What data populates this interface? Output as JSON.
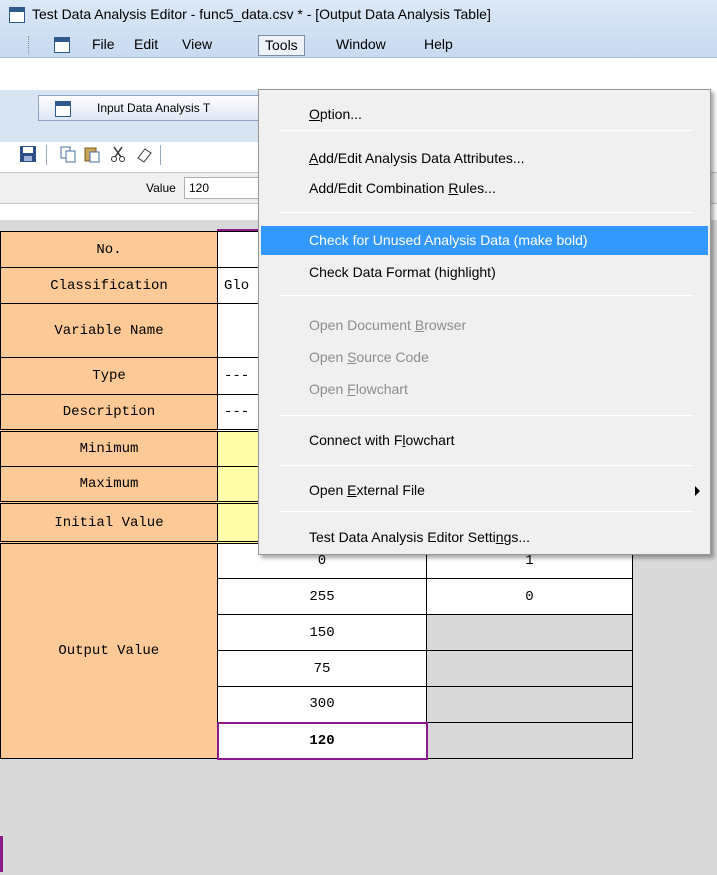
{
  "window": {
    "title": "Test Data Analysis Editor - func5_data.csv * - [Output Data Analysis Table]"
  },
  "menubar": {
    "items": [
      "File",
      "Edit",
      "View",
      "Tools",
      "Window",
      "Help"
    ],
    "open_menu": "Tools"
  },
  "tabbar": {
    "active_tab": "Input Data Analysis T"
  },
  "toolbar": {
    "icons": [
      "save-icon",
      "copy-icon",
      "paste-icon",
      "cut-icon",
      "eraser-icon"
    ]
  },
  "valuebar": {
    "label": "Value",
    "value": "120"
  },
  "grid": {
    "rows": {
      "no": "No.",
      "classification": "Classification",
      "classification_value": "Glo",
      "variable_name": "Variable Name",
      "type": "Type",
      "description": "Description",
      "minimum": "Minimum",
      "maximum": "Maximum",
      "initial_value": "Initial Value",
      "output_value": "Output Value",
      "dash1": "---",
      "dash2": "---"
    },
    "output_values": [
      {
        "c1": "0",
        "c2": "1"
      },
      {
        "c1": "255",
        "c2": "0"
      },
      {
        "c1": "150",
        "c2": ""
      },
      {
        "c1": "75",
        "c2": ""
      },
      {
        "c1": "300",
        "c2": ""
      },
      {
        "c1": "120",
        "c2": ""
      }
    ]
  },
  "tools_menu": {
    "option": "Option...",
    "add_edit_attributes": "Add/Edit Analysis Data Attributes...",
    "add_edit_rules": "Add/Edit Combination Rules...",
    "check_unused": "Check for Unused Analysis Data (make bold)",
    "check_format": "Check Data Format (highlight)",
    "open_doc_browser": "Open Document Browser",
    "open_source_code": "Open Source Code",
    "open_flowchart": "Open Flowchart",
    "connect_flowchart": "Connect with Flowchart",
    "open_external_file": "Open External File",
    "editor_settings": "Test Data Analysis Editor Settings..."
  },
  "colors": {
    "header_bg": "#fcc997",
    "yellow_cell": "#ffffaa",
    "grey_cell": "#d9d9d9",
    "highlight": "#3399ff",
    "active_border": "#8b1a8b"
  }
}
